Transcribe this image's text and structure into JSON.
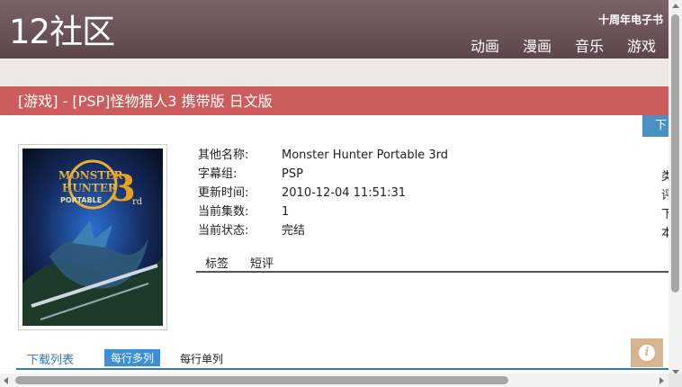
{
  "header": {
    "logo": "12社区",
    "anniversary": "十周年电子书",
    "nav": [
      "动画",
      "漫画",
      "音乐",
      "游戏"
    ]
  },
  "title": "[游戏] - [PSP]怪物猎人3 携带版 日文版",
  "download_button": "下",
  "cover": {
    "text_line1": "MONSTER",
    "text_line2": "HUNTER",
    "text_line3": "PORTABLE",
    "numeral": "3",
    "suffix": "rd"
  },
  "info": [
    {
      "label": "其他名称:",
      "value": "Monster Hunter Portable 3rd",
      "edge": "类"
    },
    {
      "label": "字幕组:",
      "value": "PSP",
      "edge": ""
    },
    {
      "label": "更新时间:",
      "value": "2010-12-04 11:51:31",
      "edge": "评"
    },
    {
      "label": "当前集数:",
      "value": "1",
      "edge": "下"
    },
    {
      "label": "当前状态:",
      "value": "完结",
      "edge": "本"
    }
  ],
  "tabs": [
    "标签",
    "短评"
  ],
  "download_list": {
    "label": "下载列表",
    "multi": "每行多列",
    "single": "每行单列"
  },
  "colors": {
    "header": "#6b5359",
    "title_bar": "#cd5c5c",
    "accent": "#3a8fd6",
    "info_icon": "#d6b58e"
  }
}
